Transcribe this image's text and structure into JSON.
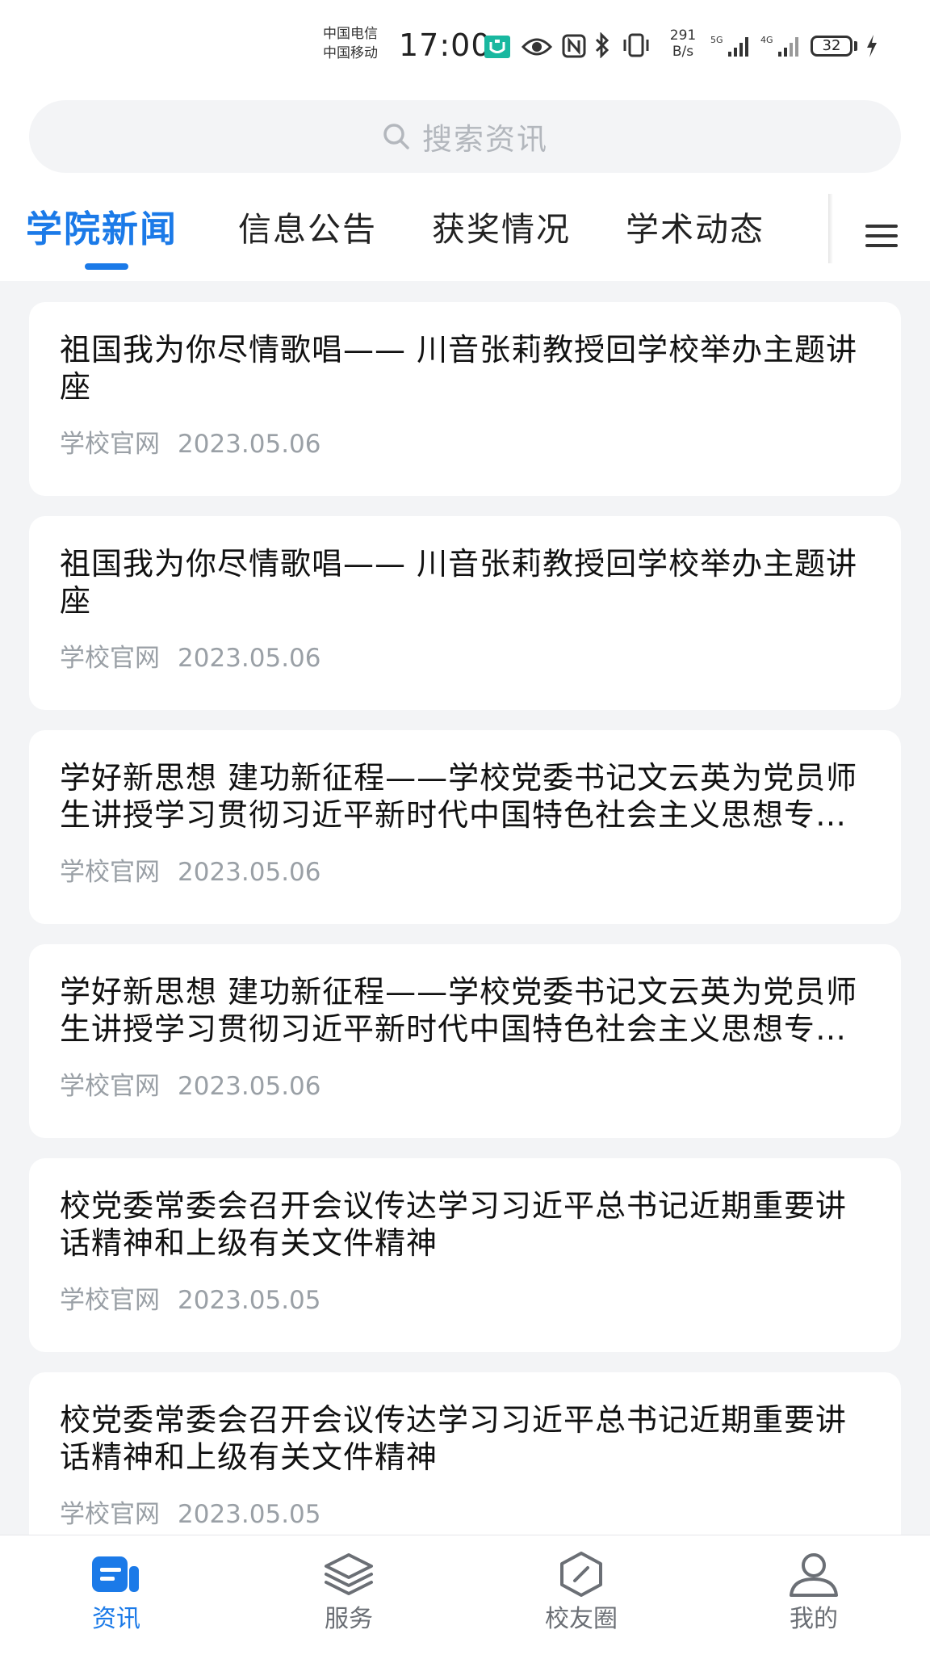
{
  "status_bar": {
    "carrier_1": "中国电信",
    "carrier_2": "中国移动",
    "time": "17:00",
    "net_speed_value": "291",
    "net_speed_unit": "B/s",
    "signal_1_label": "5G",
    "signal_2_label": "4G",
    "battery": "32",
    "icons": [
      "app-notification-icon",
      "eye-icon",
      "nfc-icon",
      "bluetooth-icon",
      "vibrate-icon",
      "signal-icon",
      "battery-icon",
      "charging-icon"
    ]
  },
  "search": {
    "placeholder": "搜索资讯",
    "icon": "search-icon"
  },
  "tabs": [
    {
      "label": "学院新闻",
      "active": true
    },
    {
      "label": "信息公告",
      "active": false
    },
    {
      "label": "获奖情况",
      "active": false
    },
    {
      "label": "学术动态",
      "active": false
    }
  ],
  "menu_icon": "menu-icon",
  "news": [
    {
      "title": "祖国我为你尽情歌唱—— 川音张莉教授回学校举办主题讲座",
      "source": "学校官网",
      "date": "2023.05.06"
    },
    {
      "title": "祖国我为你尽情歌唱—— 川音张莉教授回学校举办主题讲座",
      "source": "学校官网",
      "date": "2023.05.06"
    },
    {
      "title": "学好新思想  建功新征程——学校党委书记文云英为党员师生讲授学习贯彻习近平新时代中国特色社会主义思想专题党课",
      "source": "学校官网",
      "date": "2023.05.06"
    },
    {
      "title": "学好新思想  建功新征程——学校党委书记文云英为党员师生讲授学习贯彻习近平新时代中国特色社会主义思想专题党课",
      "source": "学校官网",
      "date": "2023.05.06"
    },
    {
      "title": "校党委常委会召开会议传达学习习近平总书记近期重要讲话精神和上级有关文件精神",
      "source": "学校官网",
      "date": "2023.05.05"
    },
    {
      "title": "校党委常委会召开会议传达学习习近平总书记近期重要讲话精神和上级有关文件精神",
      "source": "学校官网",
      "date": "2023.05.05"
    }
  ],
  "bottom_nav": [
    {
      "label": "资讯",
      "icon": "news-icon",
      "active": true
    },
    {
      "label": "服务",
      "icon": "layers-icon",
      "active": false
    },
    {
      "label": "校友圈",
      "icon": "compass-icon",
      "active": false
    },
    {
      "label": "我的",
      "icon": "user-icon",
      "active": false
    }
  ],
  "colors": {
    "accent": "#1b7ae8",
    "page_background": "#f3f4f6",
    "meta_text": "#9aa0a6",
    "nav_inactive": "#6b6f75"
  }
}
